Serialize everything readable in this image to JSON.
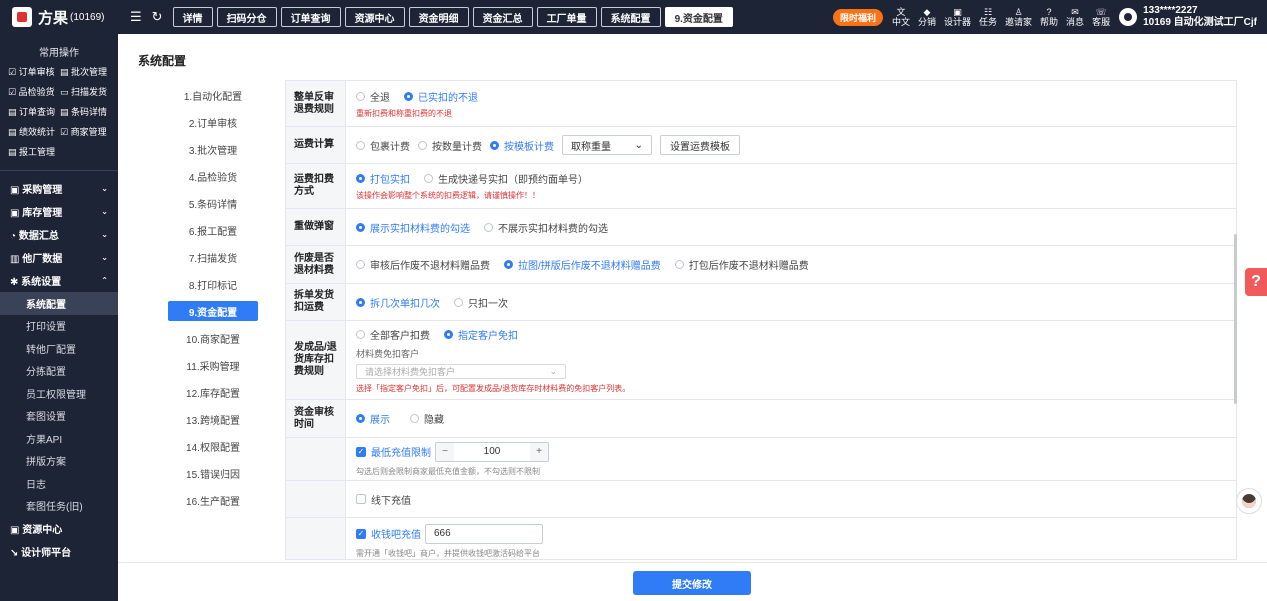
{
  "app": {
    "name": "方果",
    "id": "(10169)"
  },
  "topbar": {
    "tabs": [
      {
        "label": "详情",
        "active": false
      },
      {
        "label": "扫码分仓",
        "active": false
      },
      {
        "label": "订单查询",
        "active": false
      },
      {
        "label": "资源中心",
        "active": false
      },
      {
        "label": "资金明细",
        "active": false
      },
      {
        "label": "资金汇总",
        "active": false
      },
      {
        "label": "工厂单量",
        "active": false
      },
      {
        "label": "系统配置",
        "active": false
      },
      {
        "label": "9.资金配置",
        "active": true
      }
    ],
    "promo": "限时福利",
    "items": [
      {
        "glyph": "文",
        "label": "中文"
      },
      {
        "glyph": "◆",
        "label": "分销"
      },
      {
        "glyph": "▣",
        "label": "设计器"
      },
      {
        "glyph": "☷",
        "label": "任务"
      },
      {
        "glyph": "♙",
        "label": "邀请家"
      },
      {
        "glyph": "?",
        "label": "帮助"
      },
      {
        "glyph": "✉",
        "label": "消息"
      },
      {
        "glyph": "☏",
        "label": "客服"
      }
    ],
    "user": {
      "phone": "133****2227",
      "org": "10169 自动化测试工厂Cjf"
    }
  },
  "sidebar": {
    "common_title": "常用操作",
    "common": [
      "☑ 订单审核",
      "▤ 批次管理",
      "☑ 品检验货",
      "▭ 扫描发货",
      "▤ 订单查询",
      "▤ 条码详情",
      "▤ 绩效统计",
      "☑ 商家管理",
      "▤ 报工管理"
    ],
    "groups": [
      {
        "label": "▣ 采购管理",
        "chev": "⌄"
      },
      {
        "label": "▣ 库存管理",
        "chev": "⌄"
      },
      {
        "label": "◔ 数据汇总",
        "chev": "⌄"
      },
      {
        "label": "▥ 他厂数据",
        "chev": "⌄"
      },
      {
        "label": "✱ 系统设置",
        "chev": "⌃"
      }
    ],
    "subs": [
      {
        "label": "系统配置",
        "active": true
      },
      {
        "label": "打印设置",
        "active": false
      },
      {
        "label": "转他厂配置",
        "active": false
      },
      {
        "label": "分拣配置",
        "active": false
      },
      {
        "label": "员工权限管理",
        "active": false
      },
      {
        "label": "套图设置",
        "active": false
      },
      {
        "label": "方果API",
        "active": false
      },
      {
        "label": "拼版方案",
        "active": false
      },
      {
        "label": "日志",
        "active": false
      },
      {
        "label": "套图任务(旧)",
        "active": false
      }
    ],
    "bottom": [
      {
        "label": "▣ 资源中心"
      },
      {
        "label": "↘ 设计师平台"
      }
    ]
  },
  "page": {
    "title": "系统配置"
  },
  "leftnav": [
    {
      "label": "1.自动化配置",
      "active": false
    },
    {
      "label": "2.订单审核",
      "active": false
    },
    {
      "label": "3.批次管理",
      "active": false
    },
    {
      "label": "4.品检验货",
      "active": false
    },
    {
      "label": "5.条码详情",
      "active": false
    },
    {
      "label": "6.报工配置",
      "active": false
    },
    {
      "label": "7.扫描发货",
      "active": false
    },
    {
      "label": "8.打印标记",
      "active": false
    },
    {
      "label": "9.资金配置",
      "active": true
    },
    {
      "label": "10.商家配置",
      "active": false
    },
    {
      "label": "11.采购管理",
      "active": false
    },
    {
      "label": "12.库存配置",
      "active": false
    },
    {
      "label": "13.跨境配置",
      "active": false
    },
    {
      "label": "14.权限配置",
      "active": false
    },
    {
      "label": "15.错误归因",
      "active": false
    },
    {
      "label": "16.生产配置",
      "active": false
    }
  ],
  "form": {
    "refund_rule": {
      "label": "整单反审退费规则",
      "options": [
        "全退",
        "已实扣的不退"
      ],
      "hint": "重新扣费和称重扣费的不退"
    },
    "freight_calc": {
      "label": "运费计算",
      "options": [
        "包裹计费",
        "按数量计费",
        "按模板计费"
      ],
      "select_value": "取称重量",
      "button": "设置运费模板"
    },
    "freight_deduct": {
      "label": "运费扣费方式",
      "options": [
        "打包实扣",
        "生成快递号实扣（即预约面单号）"
      ],
      "hint": "该操作会影响整个系统的扣费逻辑，请谨慎操作！！"
    },
    "reweigh_popup": {
      "label": "重做弹窗",
      "options": [
        "展示实扣材料费的勾选",
        "不展示实扣材料费的勾选"
      ]
    },
    "scrap_refund": {
      "label": "作废是否退材料费",
      "options": [
        "审核后作废不退材料赠品费",
        "拉图/拼版后作废不退材料赠品费",
        "打包后作废不退材料赠品费"
      ]
    },
    "split_shipping": {
      "label": "拆单发货扣运费",
      "options": [
        "拆几次单扣几次",
        "只扣一次"
      ]
    },
    "finished_return": {
      "label": "发成品/退货库存扣费规则",
      "options": [
        "全部客户扣费",
        "指定客户免扣"
      ],
      "sub_label": "材料费免扣客户",
      "placeholder": "请选择材料费免扣客户",
      "hint": "选择「指定客户免扣」后，可配置发成品/退货库存时材料费的免扣客户列表。"
    },
    "fund_audit": {
      "label": "资金审核时间",
      "options": [
        "展示",
        "隐藏"
      ]
    },
    "min_recharge": {
      "label": "最低充值限制",
      "value": "100",
      "minus": "−",
      "plus": "+",
      "hint": "勾选后则会限制商家最低充值金额，不勾选则不限制"
    },
    "offline_recharge": {
      "label": "线下充值"
    },
    "shouqianba": {
      "label": "收钱吧充值",
      "value": "666",
      "hint": "需开通「收钱吧」商户，并提供收钱吧激活码给平台"
    }
  },
  "footer": {
    "submit": "提交修改"
  },
  "float": {
    "help": "?"
  }
}
